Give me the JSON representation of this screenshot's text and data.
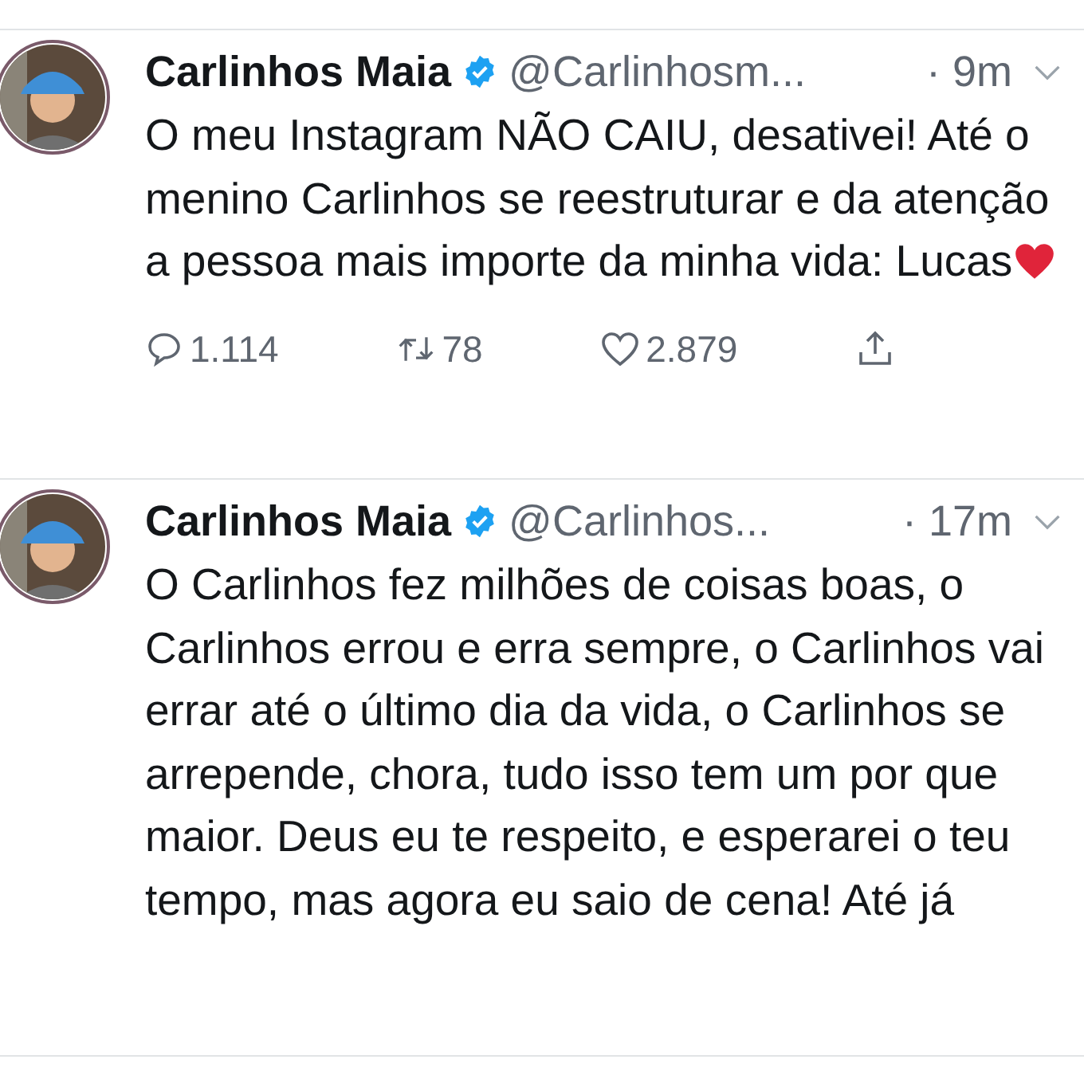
{
  "tweets": [
    {
      "name": "Carlinhos Maia",
      "verified": true,
      "handle": "@Carlinhosm...",
      "time": "· 9m",
      "text": "O meu Instagram NÃO CAIU, desativei! Até o menino Carlinhos se reestruturar e da atenção a pessoa mais importe da minha vida: Lucas",
      "heart_after_text": true,
      "actions": {
        "replies": "1.114",
        "retweets": "78",
        "likes": "2.879"
      }
    },
    {
      "name": "Carlinhos Maia",
      "verified": true,
      "handle": "@Carlinhos...",
      "time": "· 17m",
      "text": "O Carlinhos fez milhões de coisas boas, o Carlinhos errou e erra sempre, o Carlinhos vai errar até o último dia da vida, o Carlinhos se arrepende, chora, tudo isso tem um por que maior. Deus eu te respeito, e esperarei o teu tempo, mas agora eu saio de cena! Até já",
      "heart_after_text": false
    }
  ]
}
